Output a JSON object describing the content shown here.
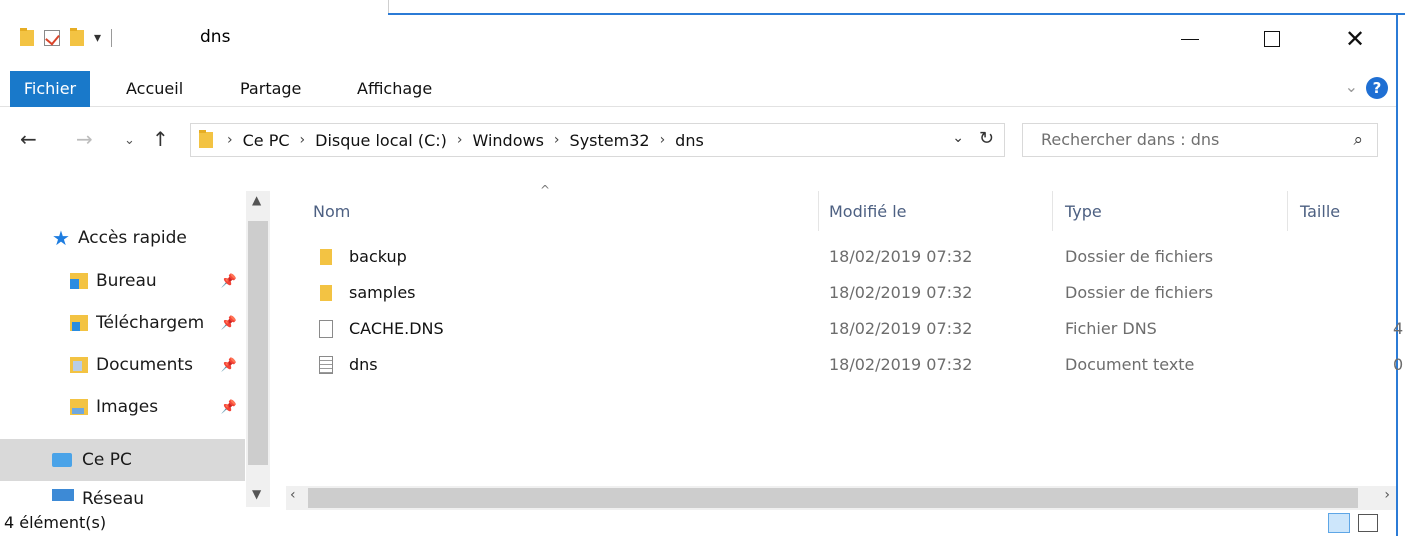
{
  "window": {
    "title": "dns"
  },
  "ribbon": {
    "tabs": [
      "Fichier",
      "Accueil",
      "Partage",
      "Affichage"
    ]
  },
  "nav": {
    "back": "←",
    "forward": "→",
    "recent": "⌄",
    "up": "↑",
    "breadcrumb": [
      "Ce PC",
      "Disque local (C:)",
      "Windows",
      "System32",
      "dns"
    ],
    "search_placeholder": "Rechercher dans : dns"
  },
  "navpane": {
    "quick_access": "Accès rapide",
    "items": [
      "Bureau",
      "Téléchargem",
      "Documents",
      "Images"
    ],
    "this_pc": "Ce PC",
    "network": "Réseau"
  },
  "columns": [
    "Nom",
    "Modifié le",
    "Type",
    "Taille"
  ],
  "files": [
    {
      "name": "backup",
      "modified": "18/02/2019 07:32",
      "type": "Dossier de fichiers",
      "icon": "folder-icon"
    },
    {
      "name": "samples",
      "modified": "18/02/2019 07:32",
      "type": "Dossier de fichiers",
      "icon": "folder-icon"
    },
    {
      "name": "CACHE.DNS",
      "modified": "18/02/2019 07:32",
      "type": "Fichier DNS",
      "icon": "file-icon"
    },
    {
      "name": "dns",
      "modified": "18/02/2019 07:32",
      "type": "Document texte",
      "icon": "text-file-icon"
    }
  ],
  "overflow": {
    "row3": "4",
    "row4": "0"
  },
  "status": {
    "count": "4 élément(s)"
  },
  "colors": {
    "accent": "#1979ca",
    "selection": "#d9d9d9"
  }
}
